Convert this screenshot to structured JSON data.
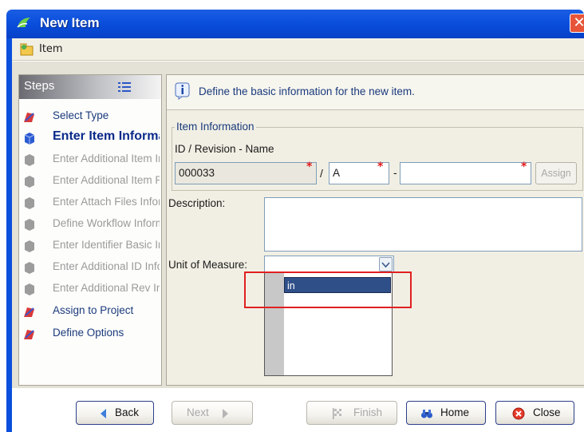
{
  "window": {
    "title": "New Item",
    "close_glyph": "✕"
  },
  "header": {
    "label": "Item"
  },
  "steps": {
    "title": "Steps",
    "items": [
      {
        "label": "Select Type",
        "state": "done"
      },
      {
        "label": "Enter Item Information",
        "state": "current"
      },
      {
        "label": "Enter Additional Item Information",
        "state": "pending"
      },
      {
        "label": "Enter Additional Item Revision Information",
        "state": "pending"
      },
      {
        "label": "Enter Attach Files Information",
        "state": "pending"
      },
      {
        "label": "Define Workflow Information",
        "state": "pending"
      },
      {
        "label": "Enter Identifier Basic Information",
        "state": "pending"
      },
      {
        "label": "Enter Additional ID Information",
        "state": "pending"
      },
      {
        "label": "Enter Additional Rev Information",
        "state": "pending"
      },
      {
        "label": "Assign to Project",
        "state": "done"
      },
      {
        "label": "Define Options",
        "state": "done"
      }
    ]
  },
  "info": {
    "text": "Define the basic information for the new item."
  },
  "item_information": {
    "legend": "Item Information",
    "id_label": "ID / Revision - Name",
    "id_value": "000033",
    "revision_value": "A",
    "name_value": "",
    "slash": "/",
    "dash": "-",
    "required_mark": "*",
    "assign_label": "Assign"
  },
  "description": {
    "label": "Description:",
    "value": ""
  },
  "unit_of_measure": {
    "label": "Unit of Measure:",
    "value": "",
    "options": [
      "in"
    ]
  },
  "buttons": {
    "back": "Back",
    "next": "Next",
    "finish": "Finish",
    "home": "Home",
    "close": "Close"
  },
  "colors": {
    "titlebar": "#0a4fdd",
    "highlight": "#e02020",
    "selected_option": "#2f4f89"
  }
}
